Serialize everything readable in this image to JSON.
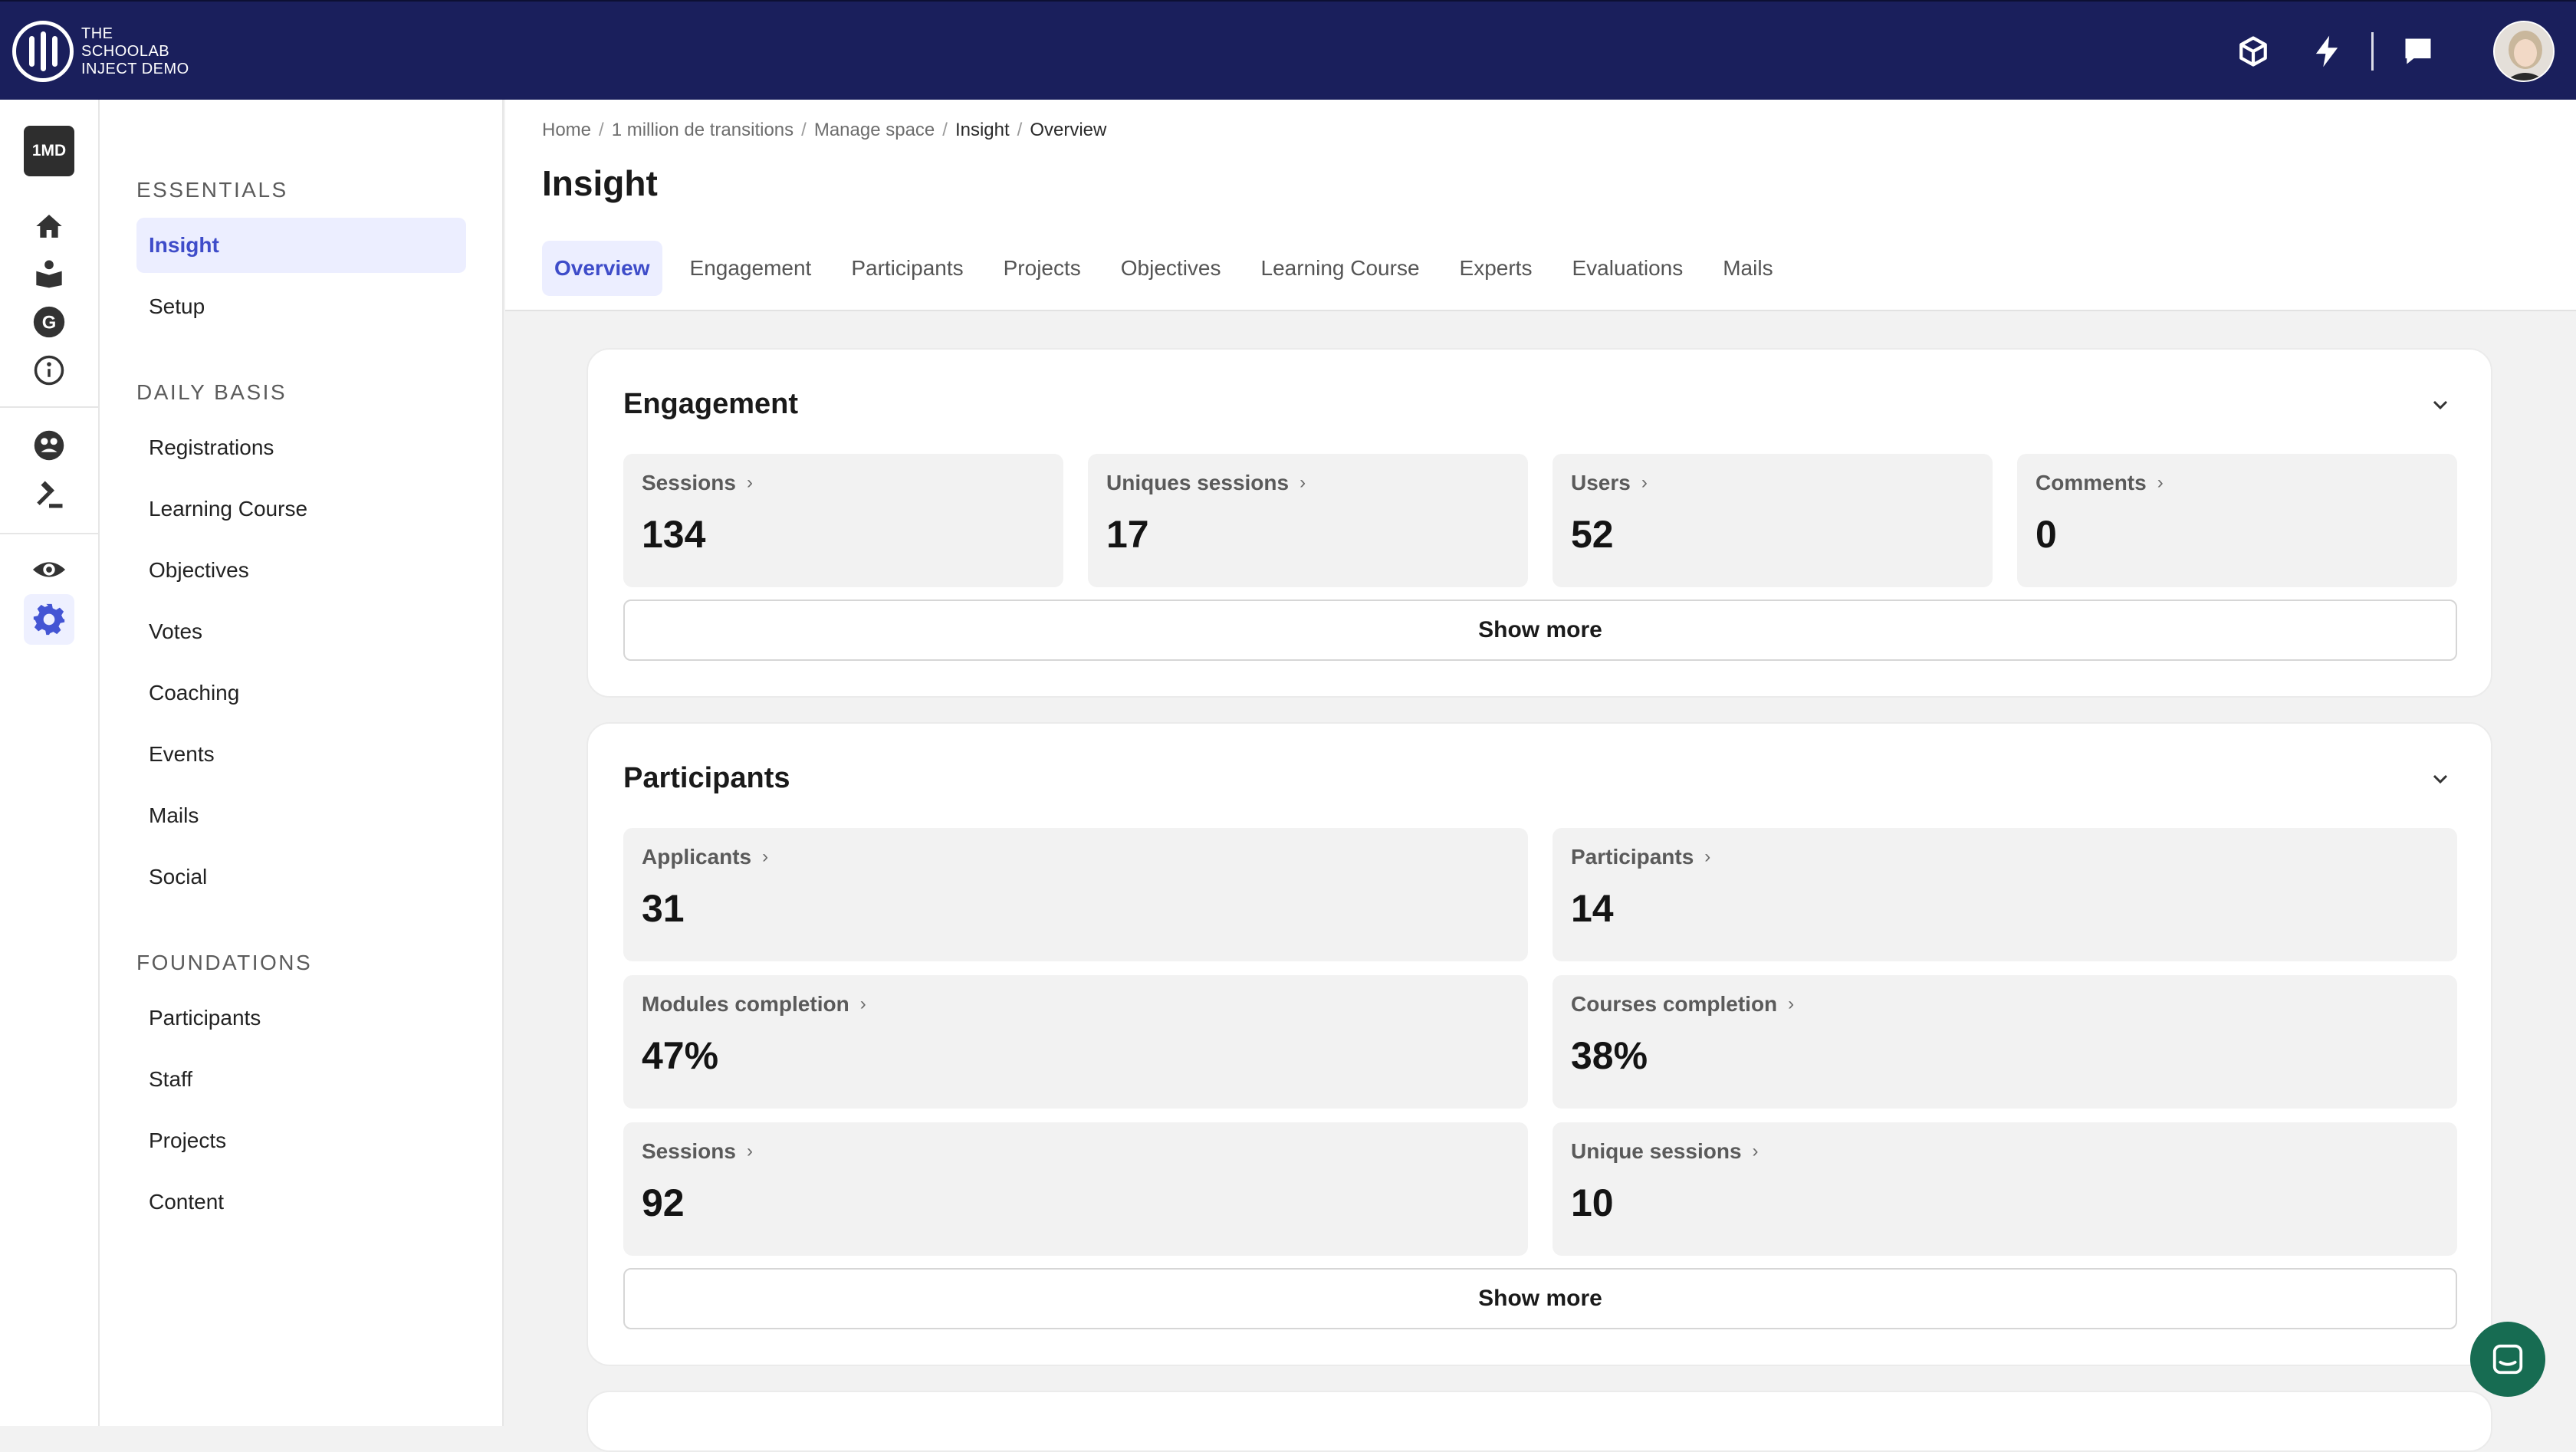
{
  "brand": {
    "line1": "THE",
    "line2": "SCHOOLAB",
    "line3": "INJECT DEMO"
  },
  "rail": {
    "space_badge": "1MD"
  },
  "sidebar": {
    "sections": [
      {
        "title": "ESSENTIALS",
        "items": [
          "Insight",
          "Setup"
        ]
      },
      {
        "title": "DAILY BASIS",
        "items": [
          "Registrations",
          "Learning Course",
          "Objectives",
          "Votes",
          "Coaching",
          "Events",
          "Mails",
          "Social"
        ]
      },
      {
        "title": "FOUNDATIONS",
        "items": [
          "Participants",
          "Staff",
          "Projects",
          "Content"
        ]
      }
    ]
  },
  "breadcrumb": [
    "Home",
    "1 million de transitions",
    "Manage space",
    "Insight",
    "Overview"
  ],
  "page": {
    "title": "Insight"
  },
  "tabs": [
    "Overview",
    "Engagement",
    "Participants",
    "Projects",
    "Objectives",
    "Learning Course",
    "Experts",
    "Evaluations",
    "Mails"
  ],
  "engagement": {
    "title": "Engagement",
    "stats": [
      {
        "label": "Sessions",
        "value": "134"
      },
      {
        "label": "Uniques sessions",
        "value": "17"
      },
      {
        "label": "Users",
        "value": "52"
      },
      {
        "label": "Comments",
        "value": "0"
      }
    ],
    "show_more": "Show more"
  },
  "participants": {
    "title": "Participants",
    "stats": [
      {
        "label": "Applicants",
        "value": "31"
      },
      {
        "label": "Participants",
        "value": "14"
      },
      {
        "label": "Modules completion",
        "value": "47%"
      },
      {
        "label": "Courses completion",
        "value": "38%"
      },
      {
        "label": "Sessions",
        "value": "92"
      },
      {
        "label": "Unique sessions",
        "value": "10"
      }
    ],
    "show_more": "Show more"
  },
  "colors": {
    "topbar": "#1a1f5c",
    "accent": "#3e4cc9",
    "active_bg": "#eceeff",
    "chat": "#176c52"
  }
}
